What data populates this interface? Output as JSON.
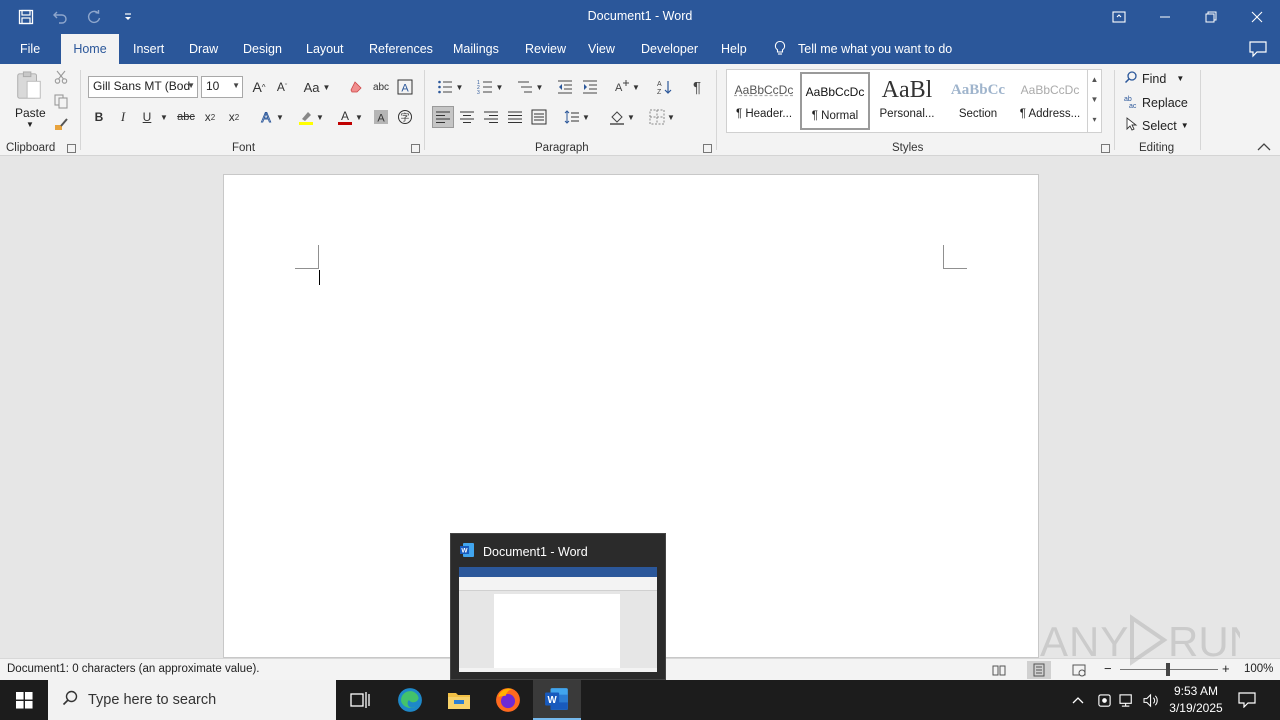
{
  "window": {
    "title": "Document1  -  Word"
  },
  "tabs": [
    {
      "label": "File"
    },
    {
      "label": "Home"
    },
    {
      "label": "Insert"
    },
    {
      "label": "Draw"
    },
    {
      "label": "Design"
    },
    {
      "label": "Layout"
    },
    {
      "label": "References"
    },
    {
      "label": "Mailings"
    },
    {
      "label": "Review"
    },
    {
      "label": "View"
    },
    {
      "label": "Developer"
    },
    {
      "label": "Help"
    }
  ],
  "tell_me": {
    "placeholder": "Tell me what you want to do"
  },
  "ribbon": {
    "clipboard": {
      "label": "Clipboard",
      "paste_label": "Paste"
    },
    "font": {
      "label": "Font",
      "font_name": "Gill Sans MT (Bod",
      "font_size": "10",
      "bold": "B",
      "italic": "I",
      "underline": "U",
      "strikethrough": "abc",
      "change_case": "Aa",
      "font_color": "#c00000",
      "highlight_color": "#ffff00"
    },
    "paragraph": {
      "label": "Paragraph",
      "pilcrow": "¶"
    },
    "styles": {
      "label": "Styles",
      "items": [
        {
          "sample": "AaBbCcDc",
          "name": "¶ Header..."
        },
        {
          "sample": "AaBbCcDc",
          "name": "¶ Normal"
        },
        {
          "sample": "AaBl",
          "name": "Personal..."
        },
        {
          "sample": "AaBbCc",
          "name": "Section"
        },
        {
          "sample": "AaBbCcDc",
          "name": "¶ Address..."
        }
      ]
    },
    "editing": {
      "label": "Editing",
      "find": "Find",
      "replace": "Replace",
      "select": "Select"
    }
  },
  "status": {
    "text": "Document1: 0 characters (an approximate value).",
    "zoom": "100%"
  },
  "taskbar": {
    "search_placeholder": "Type here to search",
    "time": "9:53 AM",
    "date": "3/19/2025"
  },
  "preview": {
    "title": "Document1 - Word"
  },
  "watermark": {
    "text": "ANY RUN"
  },
  "colors": {
    "accent": "#2b579a",
    "ribbon_bg": "#f3f3f3",
    "taskbar_bg": "#1c1c1c"
  }
}
